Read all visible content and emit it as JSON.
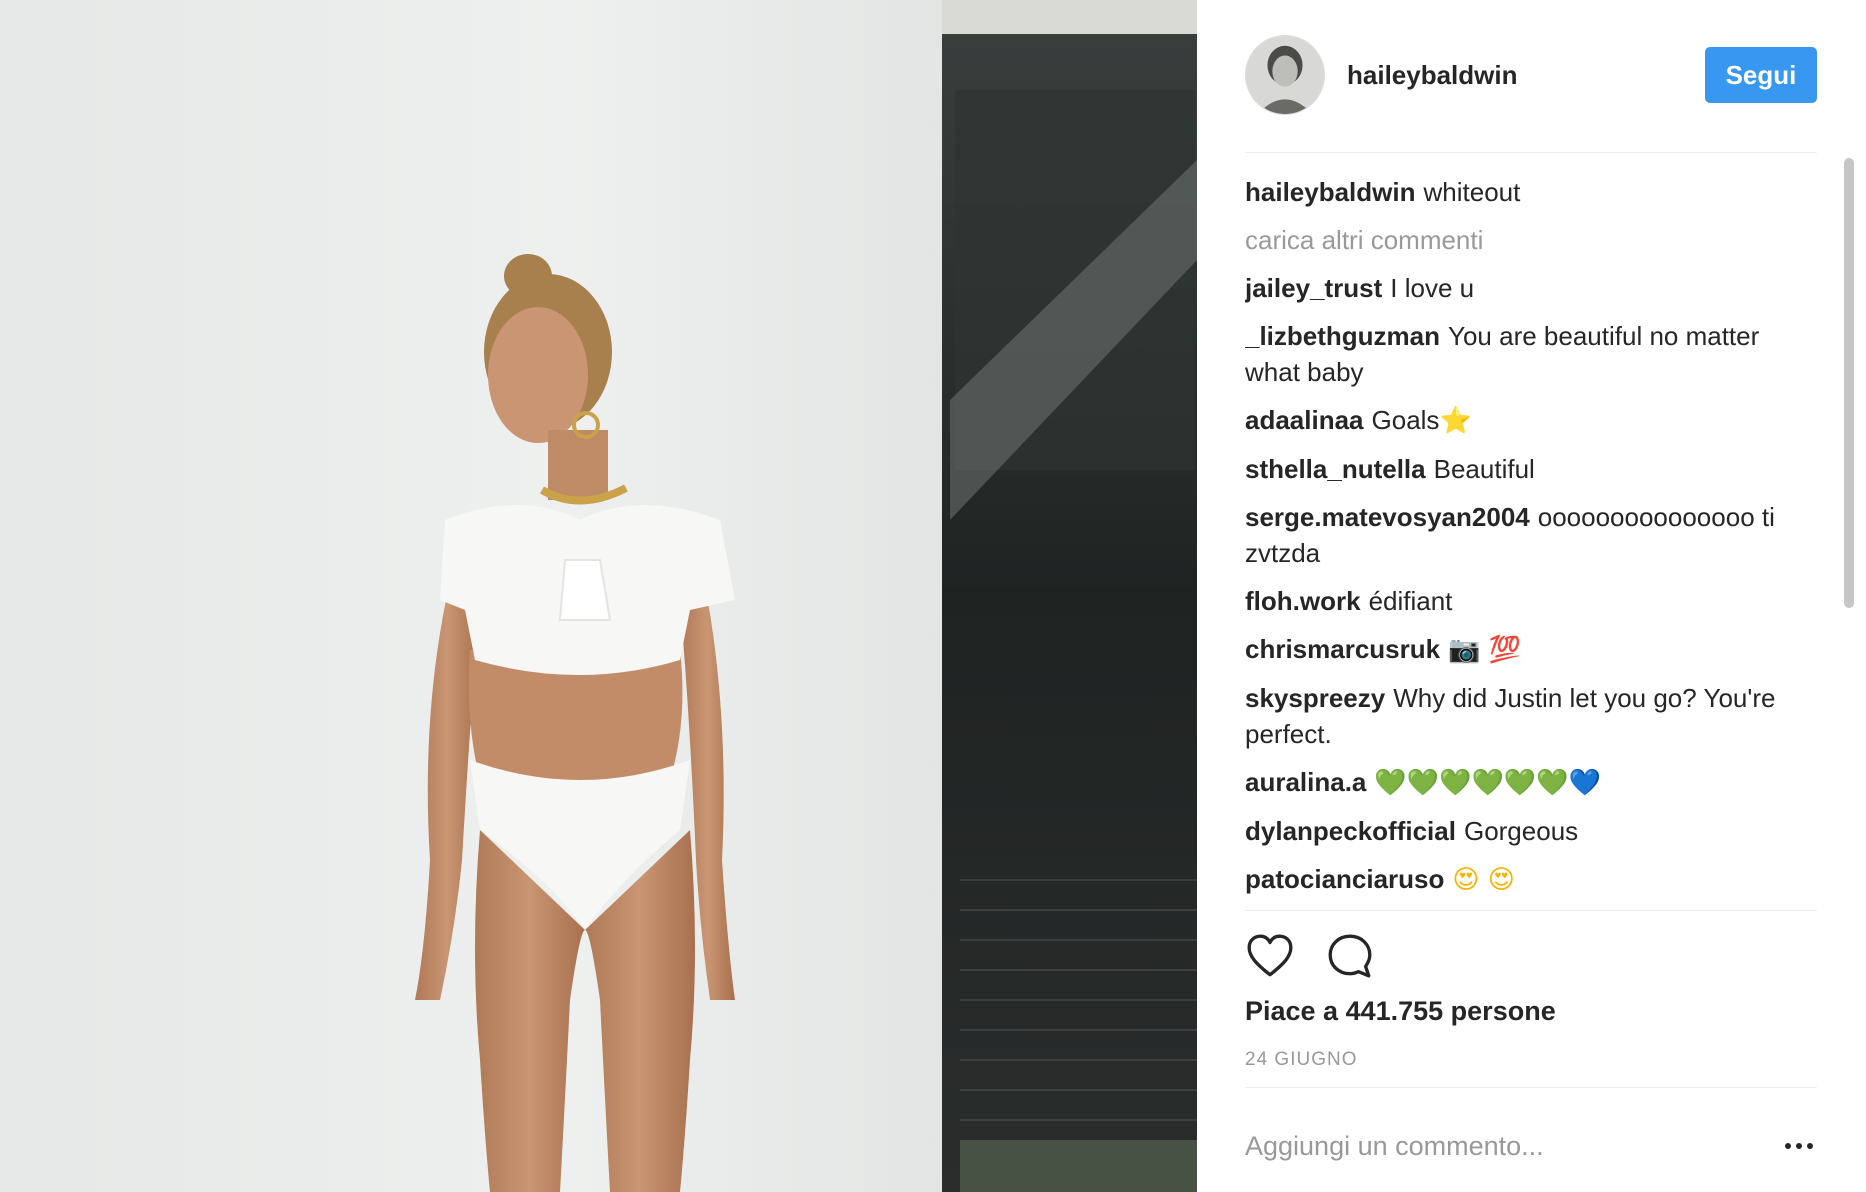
{
  "post": {
    "username": "haileybaldwin",
    "follow_label": "Segui",
    "caption": {
      "author": "haileybaldwin",
      "text": "whiteout"
    },
    "load_more_label": "carica altri commenti",
    "comments": [
      {
        "author": "jailey_trust",
        "text": "I love u",
        "emoji": "",
        "emoji_class": ""
      },
      {
        "author": "_lizbethguzman",
        "text": "You are beautiful no matter what baby",
        "emoji": "",
        "emoji_class": ""
      },
      {
        "author": "adaalinaa",
        "text": "Goals",
        "emoji": "⭐",
        "emoji_class": "e-star"
      },
      {
        "author": "sthella_nutella",
        "text": "Beautiful",
        "emoji": "",
        "emoji_class": ""
      },
      {
        "author": "serge.matevosyan2004",
        "text": "ooooooooooooooo ti zvtzda",
        "emoji": "",
        "emoji_class": ""
      },
      {
        "author": "floh.work",
        "text": "édifiant",
        "emoji": "",
        "emoji_class": ""
      },
      {
        "author": "chrismarcusruk",
        "text": "",
        "emoji": "📷 💯",
        "emoji_class": "e-red"
      },
      {
        "author": "skyspreezy",
        "text": "Why did Justin let you go? You're perfect.",
        "emoji": "",
        "emoji_class": ""
      },
      {
        "author": "auralina.a",
        "text": "",
        "emoji": "💚💚💚💚💚💚💙",
        "emoji_class": "e-green"
      },
      {
        "author": "dylanpeckofficial",
        "text": "Gorgeous",
        "emoji": "",
        "emoji_class": ""
      },
      {
        "author": "patocianciaruso",
        "text": "",
        "emoji": "😍 😍",
        "emoji_class": "e-face"
      }
    ],
    "likes_text": "Piace a 441.755 persone",
    "date_text": "24 GIUGNO",
    "comment_placeholder": "Aggiungi un commento..."
  },
  "icons": {
    "like": "heart-outline-icon",
    "comment": "speech-bubble-icon",
    "more": "more-options-icon"
  },
  "colors": {
    "follow_button": "#3897f0",
    "text_primary": "#262626",
    "text_secondary": "#999999"
  }
}
